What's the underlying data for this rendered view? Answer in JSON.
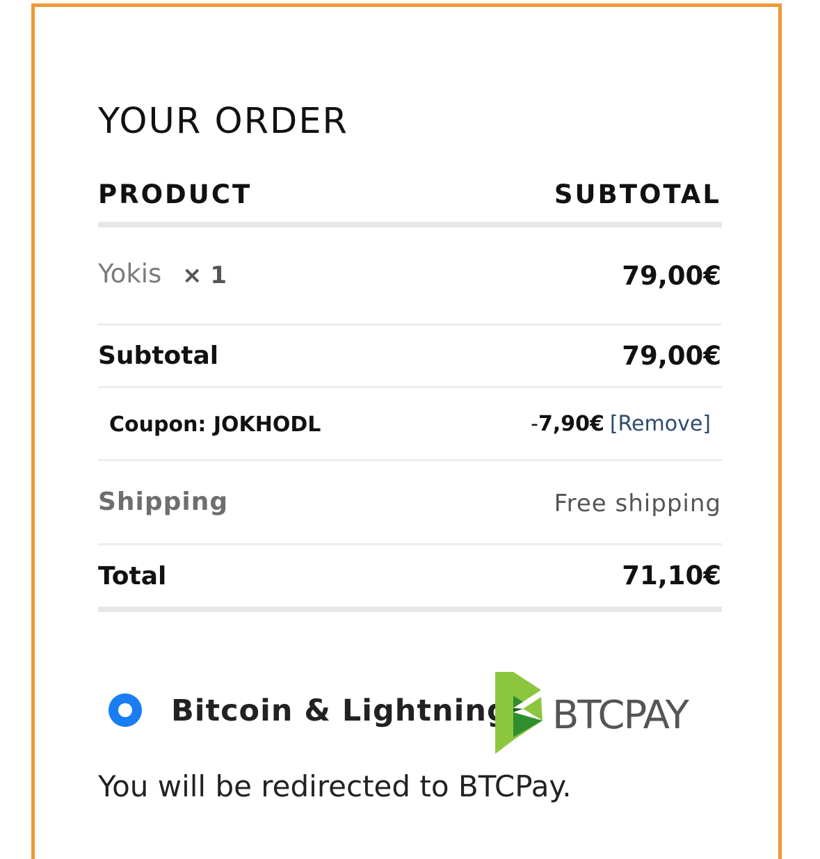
{
  "order": {
    "title": "YOUR ORDER",
    "col_product": "PRODUCT",
    "col_subtotal": "SUBTOTAL",
    "item": {
      "name": "Yokis",
      "qty": "× 1",
      "price": "79,00€"
    },
    "subtotal": {
      "label": "Subtotal",
      "value": "79,00€"
    },
    "coupon": {
      "label": "Coupon: JOKHODL",
      "prefix": "-",
      "amount": "7,90€",
      "remove": "[Remove]"
    },
    "shipping": {
      "label": "Shipping",
      "value": "Free shipping"
    },
    "total": {
      "label": "Total",
      "value": "71,10€"
    }
  },
  "payment": {
    "method_label": "Bitcoin & Lightning",
    "logo_text": "BTCPAY",
    "logo_icon": "btcpay-logo-icon",
    "selected": true,
    "note": "You will be redirected to BTCPay."
  },
  "colors": {
    "border_accent": "#ee9a33",
    "radio": "#1a7ef2",
    "link": "#2e4a6e",
    "logo_green_dark": "#2f8f2f",
    "logo_green_light": "#8cc63f"
  }
}
